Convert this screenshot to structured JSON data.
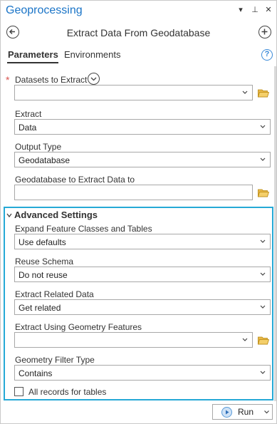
{
  "app_title": "Geoprocessing",
  "title_controls": {
    "dropdown": "▾",
    "pin": "⊥",
    "close": "✕"
  },
  "tool_title": "Extract Data From Geodatabase",
  "tabs": [
    {
      "label": "Parameters",
      "active": true
    },
    {
      "label": "Environments",
      "active": false
    }
  ],
  "help_label": "?",
  "params": {
    "datasets": {
      "label": "Datasets to Extract",
      "required_mark": "*",
      "value": ""
    },
    "extract": {
      "label": "Extract",
      "value": "Data"
    },
    "output_type": {
      "label": "Output Type",
      "value": "Geodatabase"
    },
    "gdb_target": {
      "label": "Geodatabase to Extract Data to",
      "value": ""
    }
  },
  "advanced": {
    "header": "Advanced Settings",
    "expand": {
      "label": "Expand Feature Classes and Tables",
      "value": "Use defaults"
    },
    "reuse_schema": {
      "label": "Reuse Schema",
      "value": "Do not reuse"
    },
    "related": {
      "label": "Extract Related Data",
      "value": "Get related"
    },
    "geometry_features": {
      "label": "Extract Using Geometry Features",
      "value": ""
    },
    "filter_type": {
      "label": "Geometry Filter Type",
      "value": "Contains"
    },
    "all_records": {
      "label": "All records for tables",
      "checked": false
    }
  },
  "run_label": "Run",
  "colors": {
    "accent": "#1a74c7",
    "highlight_border": "#26a9d6",
    "folder": "#e8b84a"
  }
}
